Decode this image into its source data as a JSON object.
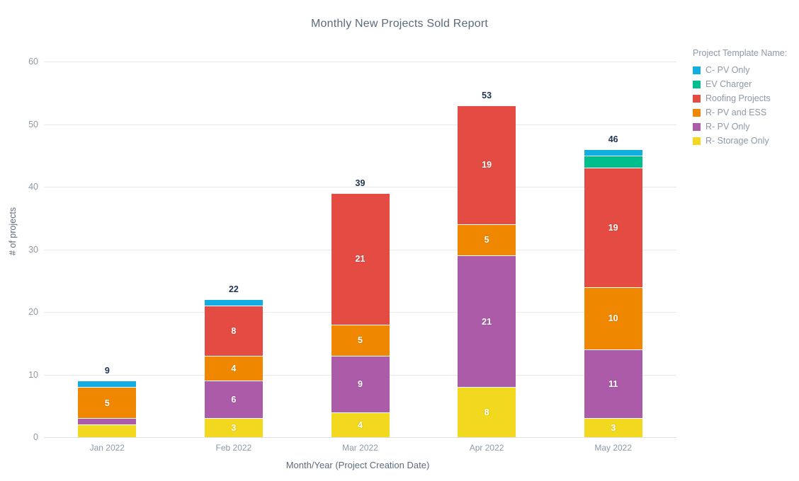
{
  "chart_data": {
    "type": "bar",
    "title": "Monthly New Projects Sold Report",
    "xlabel": "Month/Year (Project Creation Date)",
    "ylabel": "# of projects",
    "ylim": [
      0,
      60
    ],
    "yticks": [
      0,
      10,
      20,
      30,
      40,
      50,
      60
    ],
    "grid": true,
    "stacked": true,
    "legend_position": "right",
    "legend_title": "Project Template Name:",
    "categories": [
      "Jan 2022",
      "Feb 2022",
      "Mar 2022",
      "Apr 2022",
      "May 2022"
    ],
    "series": [
      {
        "name": "R- Storage Only",
        "color": "#F2D81E",
        "values": [
          2,
          3,
          4,
          8,
          3
        ]
      },
      {
        "name": "R- PV Only",
        "color": "#AB5BA8",
        "values": [
          1,
          6,
          9,
          21,
          11
        ]
      },
      {
        "name": "R- PV and ESS",
        "color": "#F08700",
        "values": [
          5,
          4,
          5,
          5,
          10
        ]
      },
      {
        "name": "Roofing Projects",
        "color": "#E34B43",
        "values": [
          0,
          8,
          21,
          19,
          19
        ]
      },
      {
        "name": "EV Charger",
        "color": "#00BF8F",
        "values": [
          0,
          0,
          0,
          0,
          2
        ]
      },
      {
        "name": "C- PV Only",
        "color": "#12AEE1",
        "values": [
          1,
          1,
          0,
          0,
          1
        ]
      }
    ],
    "totals": [
      9,
      22,
      39,
      53,
      46
    ],
    "legend_order": [
      {
        "name": "C- PV Only",
        "color": "#12AEE1"
      },
      {
        "name": "EV Charger",
        "color": "#00BF8F"
      },
      {
        "name": "Roofing Projects",
        "color": "#E34B43"
      },
      {
        "name": "R- PV and ESS",
        "color": "#F08700"
      },
      {
        "name": "R- PV Only",
        "color": "#AB5BA8"
      },
      {
        "name": "R- Storage Only",
        "color": "#F2D81E"
      }
    ]
  }
}
